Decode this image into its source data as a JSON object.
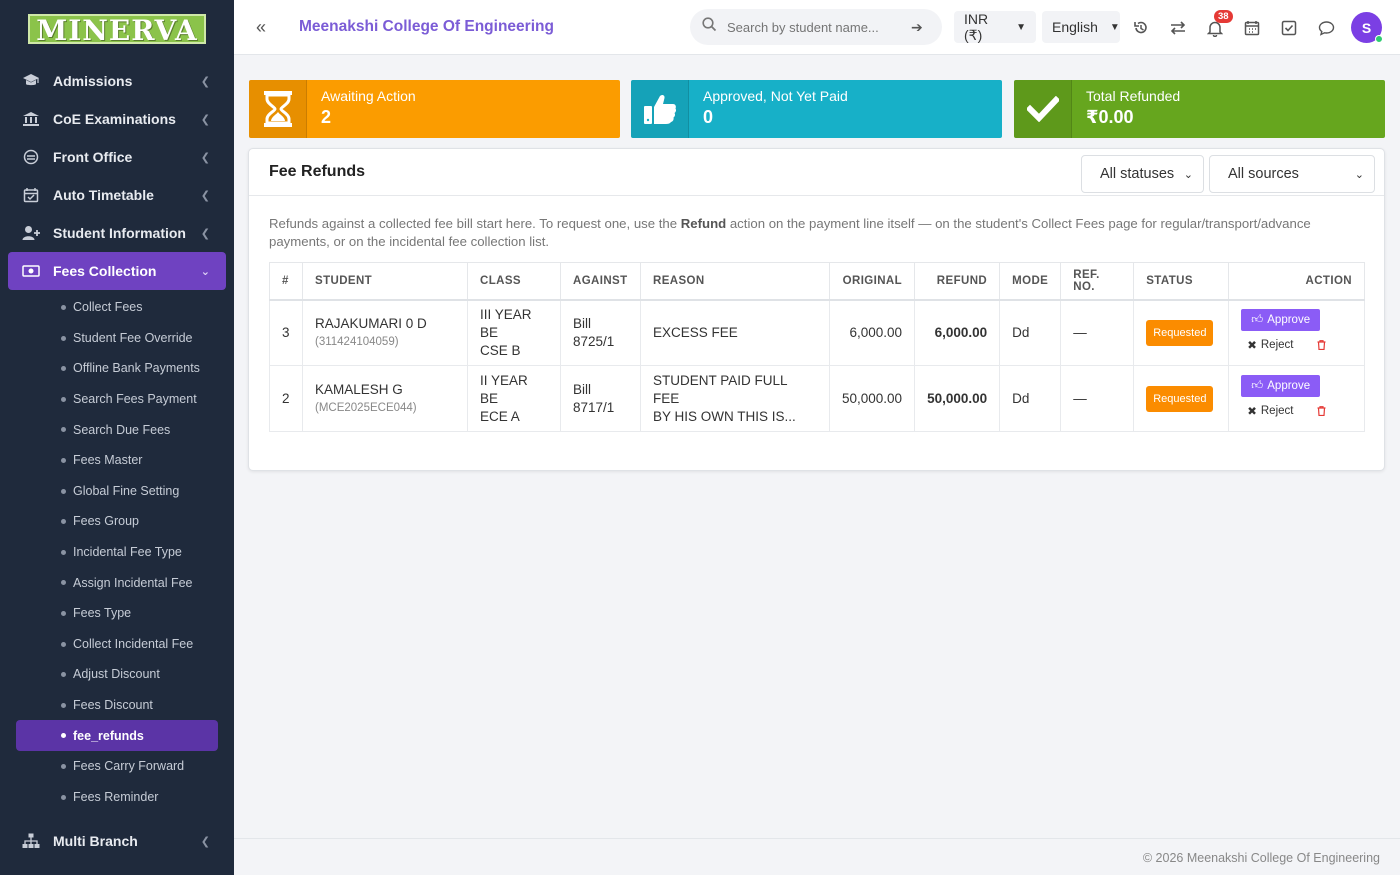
{
  "brand": {
    "logo_text": "MINERVA"
  },
  "sidebar": {
    "items": [
      {
        "label": "Admissions",
        "icon": "graduation-cap-icon"
      },
      {
        "label": "CoE Examinations",
        "icon": "bank-icon"
      },
      {
        "label": "Front Office",
        "icon": "front-office-icon"
      },
      {
        "label": "Auto Timetable",
        "icon": "calendar-check-icon"
      },
      {
        "label": "Student Information",
        "icon": "user-plus-icon"
      },
      {
        "label": "Fees Collection",
        "icon": "money-icon"
      }
    ],
    "sub_items": [
      "Collect Fees",
      "Student Fee Override",
      "Offline Bank Payments",
      "Search Fees Payment",
      "Search Due Fees",
      "Fees Master",
      "Global Fine Setting",
      "Fees Group",
      "Incidental Fee Type",
      "Assign Incidental Fee",
      "Fees Type",
      "Collect Incidental Fee",
      "Adjust Discount",
      "Fees Discount",
      "fee_refunds",
      "Fees Carry Forward",
      "Fees Reminder"
    ],
    "bottom_items": [
      {
        "label": "Multi Branch",
        "icon": "sitemap-icon"
      }
    ]
  },
  "header": {
    "college_name": "Meenakshi College Of Engineering",
    "search_placeholder": "Search by student name...",
    "currency": "INR (₹)",
    "language": "English",
    "notification_count": "38",
    "avatar_initial": "S"
  },
  "stats": [
    {
      "label": "Awaiting Action",
      "value": "2",
      "color": "#fb9c00",
      "icon": "hourglass-icon"
    },
    {
      "label": "Approved, Not Yet Paid",
      "value": "0",
      "color": "#17b0c8",
      "icon": "thumbs-up-icon"
    },
    {
      "label": "Total Refunded",
      "value": "₹0.00",
      "color": "#66a61e",
      "icon": "check-icon"
    }
  ],
  "panel": {
    "title": "Fee Refunds",
    "filter_status": "All statuses",
    "filter_source": "All sources",
    "intro_before": "Refunds against a collected fee bill start here. To request one, use the ",
    "intro_bold": "Refund",
    "intro_after": " action on the payment line itself — on the student's Collect Fees page for regular/transport/advance payments, or on the incidental fee collection list."
  },
  "table": {
    "headers": [
      "#",
      "STUDENT",
      "CLASS",
      "AGAINST",
      "REASON",
      "ORIGINAL",
      "REFUND",
      "MODE",
      "REF. NO.",
      "STATUS",
      "ACTION"
    ],
    "rows": [
      {
        "num": "3",
        "student": "RAJAKUMARI 0 D",
        "student_id": "(311424104059)",
        "class1": "III YEAR BE",
        "class2": "CSE B",
        "against1": "Bill",
        "against2": "8725/1",
        "reason1": "EXCESS FEE",
        "reason2": "",
        "original": "6,000.00",
        "refund": "6,000.00",
        "mode": "Dd",
        "ref": "—",
        "status": "Requested"
      },
      {
        "num": "2",
        "student": "KAMALESH G",
        "student_id": "(MCE2025ECE044)",
        "class1": "II YEAR BE",
        "class2": "ECE A",
        "against1": "Bill",
        "against2": "8717/1",
        "reason1": "STUDENT PAID FULL FEE",
        "reason2": "BY HIS OWN THIS IS...",
        "original": "50,000.00",
        "refund": "50,000.00",
        "mode": "Dd",
        "ref": "—",
        "status": "Requested"
      }
    ],
    "approve_label": "Approve",
    "reject_label": "Reject"
  },
  "footer": {
    "text": "© 2026 Meenakshi College Of Engineering"
  }
}
